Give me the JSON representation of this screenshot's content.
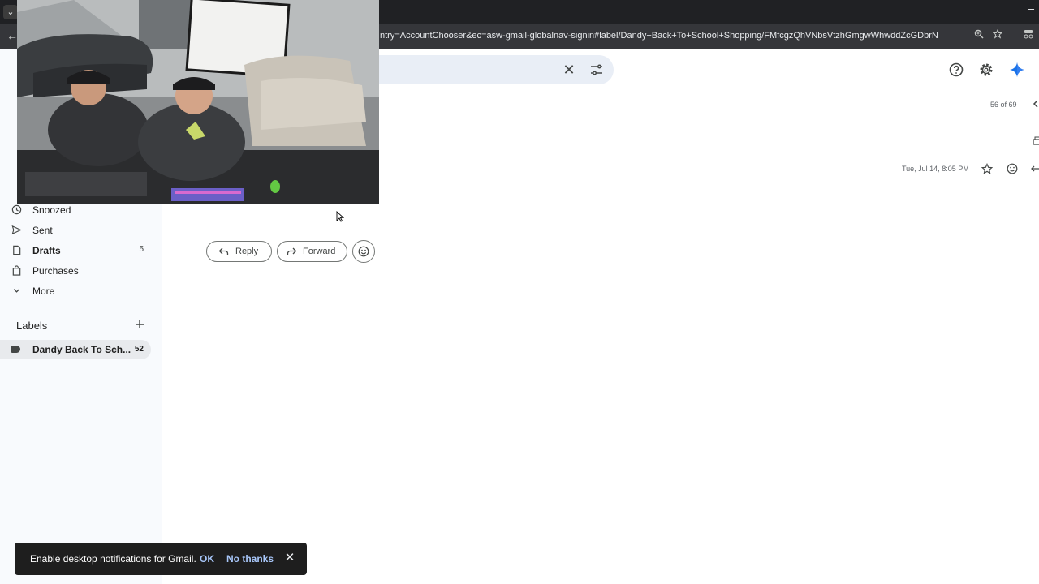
{
  "browser": {
    "url": "ntry=AccountChooser&ec=asw-gmail-globalnav-signin#label/Dandy+Back+To+School+Shopping/FMfcgzQhVNbsVtzhGmgwWhwddZcGDbrN",
    "minimize_glyph": "–",
    "tab_menu_glyph": "⌄",
    "back_glyph": "←"
  },
  "search": {
    "clear_glyph": "✕"
  },
  "sidebar": {
    "items": [
      {
        "label": "Snoozed",
        "icon": "clock-icon",
        "count": ""
      },
      {
        "label": "Sent",
        "icon": "send-icon",
        "count": ""
      },
      {
        "label": "Drafts",
        "icon": "draft-icon",
        "count": "5"
      },
      {
        "label": "Purchases",
        "icon": "shopping-bag-icon",
        "count": ""
      },
      {
        "label": "More",
        "icon": "chevron-down-icon",
        "count": ""
      }
    ],
    "labels_header": "Labels",
    "label_items": [
      {
        "label": "Dandy Back To Sch...",
        "count": "52"
      }
    ]
  },
  "thread": {
    "pager": "56 of 69",
    "date": "Tue, Jul 14, 8:05 PM",
    "reply_label": "Reply",
    "forward_label": "Forward"
  },
  "snackbar": {
    "message": "Enable desktop notifications for Gmail.",
    "ok": "OK",
    "no_thanks": "No thanks",
    "close_glyph": "✕"
  },
  "colors": {
    "sidebar_bg": "#f8fafd",
    "search_bg": "#e9eef6",
    "snackbar_bg": "#1e1e1e",
    "snackbar_link": "#a8c7fa",
    "gemini_blue": "#1a73e8"
  }
}
